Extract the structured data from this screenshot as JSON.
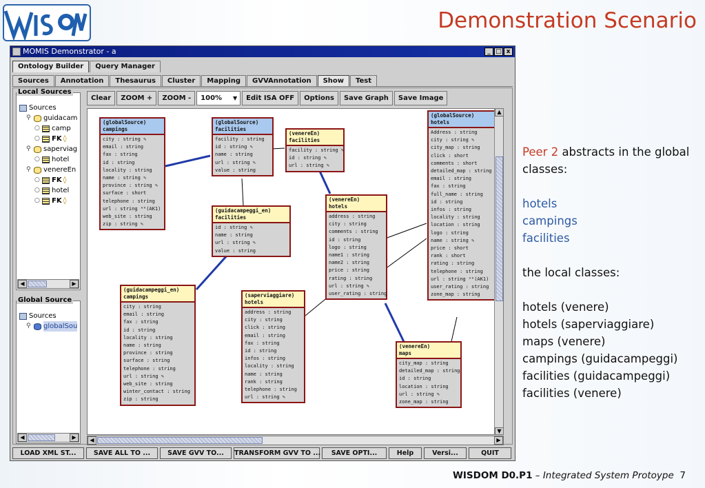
{
  "slide": {
    "title": "Demonstration Scenario",
    "footer": {
      "project": "WISDOM D0.P1",
      "dash": " – ",
      "subtitle": "Integrated System Protoype",
      "page": "7"
    }
  },
  "window": {
    "title": "MOMIS Demonstrator - a",
    "controls": [
      "_",
      "□",
      "x"
    ],
    "main_tabs": [
      "Ontology Builder",
      "Query Manager"
    ],
    "active_main_tab": "Ontology Builder",
    "sub_tabs": [
      "Sources",
      "Annotation",
      "Thesaurus",
      "Cluster",
      "Mapping",
      "GVVAnnotation",
      "Show",
      "Test"
    ],
    "active_sub_tab": "Show"
  },
  "local_sources": {
    "title": "Local Sources",
    "items": [
      {
        "label": "Sources",
        "icon": "folder-icon",
        "indent": 0
      },
      {
        "label": "guidacam",
        "icon": "database-icon",
        "indent": 1
      },
      {
        "label": "camp",
        "icon": "table-icon",
        "indent": 2
      },
      {
        "label": "FK",
        "icon": "table-icon",
        "indent": 2,
        "fk": true
      },
      {
        "label": "saperviag",
        "icon": "database-icon",
        "indent": 1
      },
      {
        "label": "hotel",
        "icon": "table-icon",
        "indent": 2
      },
      {
        "label": "venereEn",
        "icon": "database-icon",
        "indent": 1
      },
      {
        "label": "FK",
        "icon": "table-icon",
        "indent": 2,
        "fk": true
      },
      {
        "label": "hotel",
        "icon": "table-icon",
        "indent": 2
      },
      {
        "label": "FK",
        "icon": "table-icon",
        "indent": 2,
        "fk": true
      }
    ]
  },
  "global_source": {
    "title": "Global Source",
    "items": [
      {
        "label": "Sources",
        "icon": "folder-icon",
        "indent": 0
      },
      {
        "label": "globalSou",
        "icon": "database-icon",
        "indent": 1,
        "selected": true
      }
    ]
  },
  "toolbar": {
    "clear": "Clear",
    "zoom_in": "ZOOM +",
    "zoom_out": "ZOOM -",
    "zoom": "100%",
    "edit_isa": "Edit ISA OFF",
    "options": "Options",
    "save_graph": "Save Graph",
    "save_image": "Save Image"
  },
  "graph": {
    "classes": [
      {
        "id": "g-campings",
        "kind": "global",
        "source": "(globalSource)",
        "name": "campings",
        "attrs": [
          "city : string ✎",
          "email : string",
          "fax : string",
          "id : string",
          "locality : string",
          "name : string ✎",
          "province : string ✎",
          "surface : short",
          "telephone : string",
          "url : string ᴬᴷ(AK1)",
          "web_site : string",
          "zip : string ✎"
        ]
      },
      {
        "id": "g-facilities",
        "kind": "global",
        "source": "(globalSource)",
        "name": "facilities",
        "attrs": [
          "facility : string",
          "id : string ✎",
          "name : string",
          "url : string ✎",
          "value : string"
        ]
      },
      {
        "id": "v-facilities",
        "kind": "local",
        "source": "(venereEn)",
        "name": "facilities",
        "attrs": [
          "facility : string ✎",
          "id : string ✎",
          "url : string ✎"
        ]
      },
      {
        "id": "g-hotels",
        "kind": "global",
        "source": "(globalSource)",
        "name": "hotels",
        "attrs": [
          "Address : string",
          "city : string ✎",
          "city_map : string",
          "click : short",
          "comments : short",
          "detailed_map : string",
          "email : string",
          "fax : string",
          "full_name : string",
          "id : string",
          "infos : string",
          "locality : string",
          "location : string",
          "logo : string",
          "name : string ✎",
          "price : short",
          "rank : short",
          "rating : string",
          "telephone : string",
          "url : string ᴬᴷ(AK1)",
          "user_rating : string",
          "zone_map : string"
        ]
      },
      {
        "id": "gc-facilities",
        "kind": "local",
        "source": "(guidacampeggi_en)",
        "name": "facilities",
        "attrs": [
          "id : string ✎",
          "name : string",
          "url : string ✎",
          "value : string"
        ]
      },
      {
        "id": "v-hotels",
        "kind": "local",
        "source": "(venereEn)",
        "name": "hotels",
        "attrs": [
          "address : string",
          "city : string",
          "comments : string",
          "id : string",
          "logo : string",
          "name1 : string",
          "name2 : string",
          "price : string",
          "rating : string",
          "url : string ✎",
          "user_rating : string"
        ]
      },
      {
        "id": "gc-campings",
        "kind": "local",
        "source": "(guidacampeggi_en)",
        "name": "campings",
        "attrs": [
          "city : string",
          "email : string",
          "fax : string",
          "id : string",
          "locality : string",
          "name : string",
          "province : string",
          "surface : string",
          "telephone : string",
          "url : string ✎",
          "web_site : string",
          "winter_contact : string",
          "zip : string"
        ]
      },
      {
        "id": "s-hotels",
        "kind": "local",
        "source": "(saperviaggiare)",
        "name": "hotels",
        "attrs": [
          "address : string",
          "city : string",
          "click : string",
          "email : string",
          "fax : string",
          "id : string",
          "infos : string",
          "locality : string",
          "name : string",
          "rank : string",
          "telephone : string",
          "url : string ✎"
        ]
      },
      {
        "id": "v-maps",
        "kind": "local",
        "source": "(venereEn)",
        "name": "maps",
        "attrs": [
          "city_map : string",
          "detailed_map : string",
          "id : string",
          "location : string",
          "url : string ✎",
          "zone_map : string"
        ]
      }
    ]
  },
  "bottom_buttons": [
    "LOAD XML ST...",
    "SAVE ALL TO ...",
    "SAVE GVV TO...",
    "TRANSFORM GVV TO ...",
    "SAVE OPTI...",
    "Help",
    "Versi...",
    "QUIT"
  ],
  "notes": {
    "peer": "Peer 2",
    "intro": " abstracts in the global classes:",
    "global_classes": [
      "hotels",
      "campings",
      "facilities"
    ],
    "local_intro": "the local classes:",
    "local_classes": [
      "hotels (venere)",
      "hotels (saperviaggiare)",
      "maps (venere)",
      "campings (guidacampeggi)",
      "facilities (guidacampeggi)",
      "facilities (venere)"
    ]
  },
  "colors": {
    "accent": "#c53a22",
    "link_blue": "#2d5aa3",
    "titlebar": "#0c1d7e",
    "global_header": "#a9c9ee",
    "local_header": "#fff6bd",
    "class_border": "#8b1515"
  }
}
